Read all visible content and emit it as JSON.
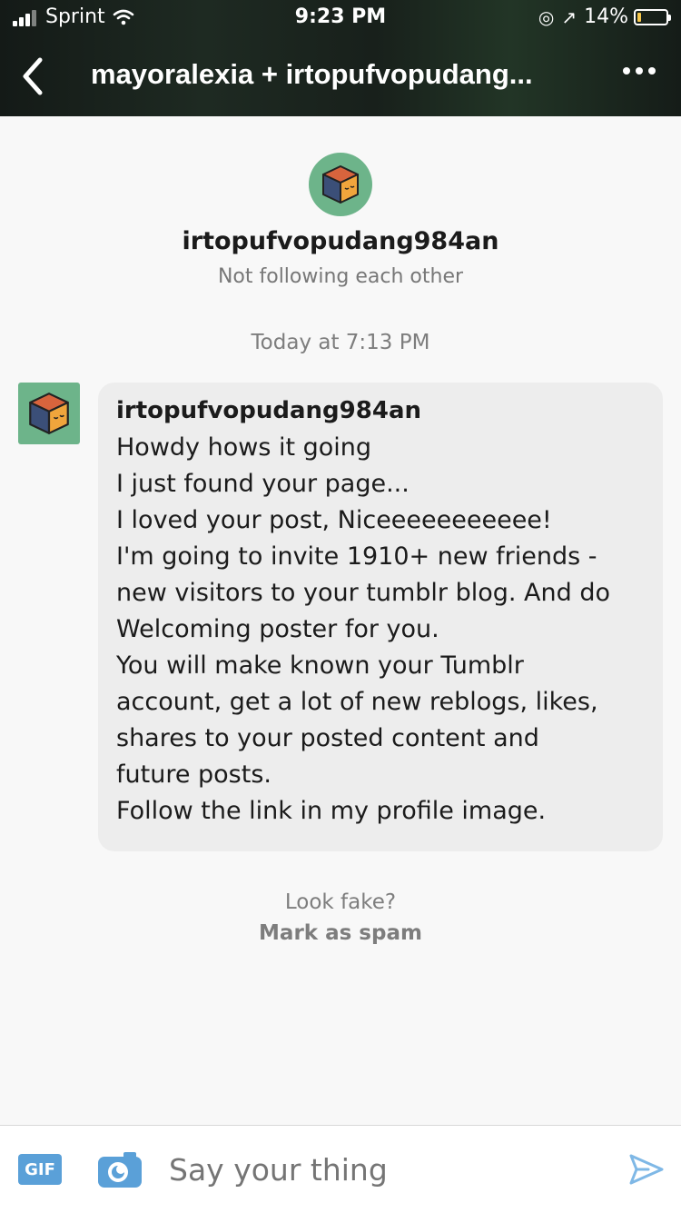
{
  "status_bar": {
    "carrier": "Sprint",
    "time": "9:23 PM",
    "battery": "14%",
    "battery_fill": 0.14
  },
  "header": {
    "title": "mayoralexia + irtopufvopudang...",
    "back_icon": "chevron-left-icon",
    "more_icon": "more-dots-icon"
  },
  "profile": {
    "name": "irtopufvopudang984an",
    "relationship": "Not following each other"
  },
  "conversation": {
    "timestamp": "Today at 7:13 PM",
    "messages": [
      {
        "sender": "irtopufvopudang984an",
        "lines": [
          "Howdy hows it going",
          "I just found your page...",
          "I loved your post, Niceeeeeeeeeee!",
          "I'm going to invite 1910+ new friends -",
          "new visitors to your tumblr blog. And do",
          "Welcoming poster for you.",
          "You will make known your Tumblr",
          "account,  get a lot of new reblogs, likes,",
          "shares to your posted content and",
          "future posts.",
          "Follow the link in my profile image."
        ]
      }
    ]
  },
  "spam_prompt": {
    "question": "Look fake?",
    "action": "Mark as spam"
  },
  "composer": {
    "gif_label": "GIF",
    "placeholder": "Say your thing"
  },
  "colors": {
    "avatar_bg": "#6db48a",
    "gif_bg": "#5aa0d8",
    "send_icon": "#7fb8e6"
  }
}
